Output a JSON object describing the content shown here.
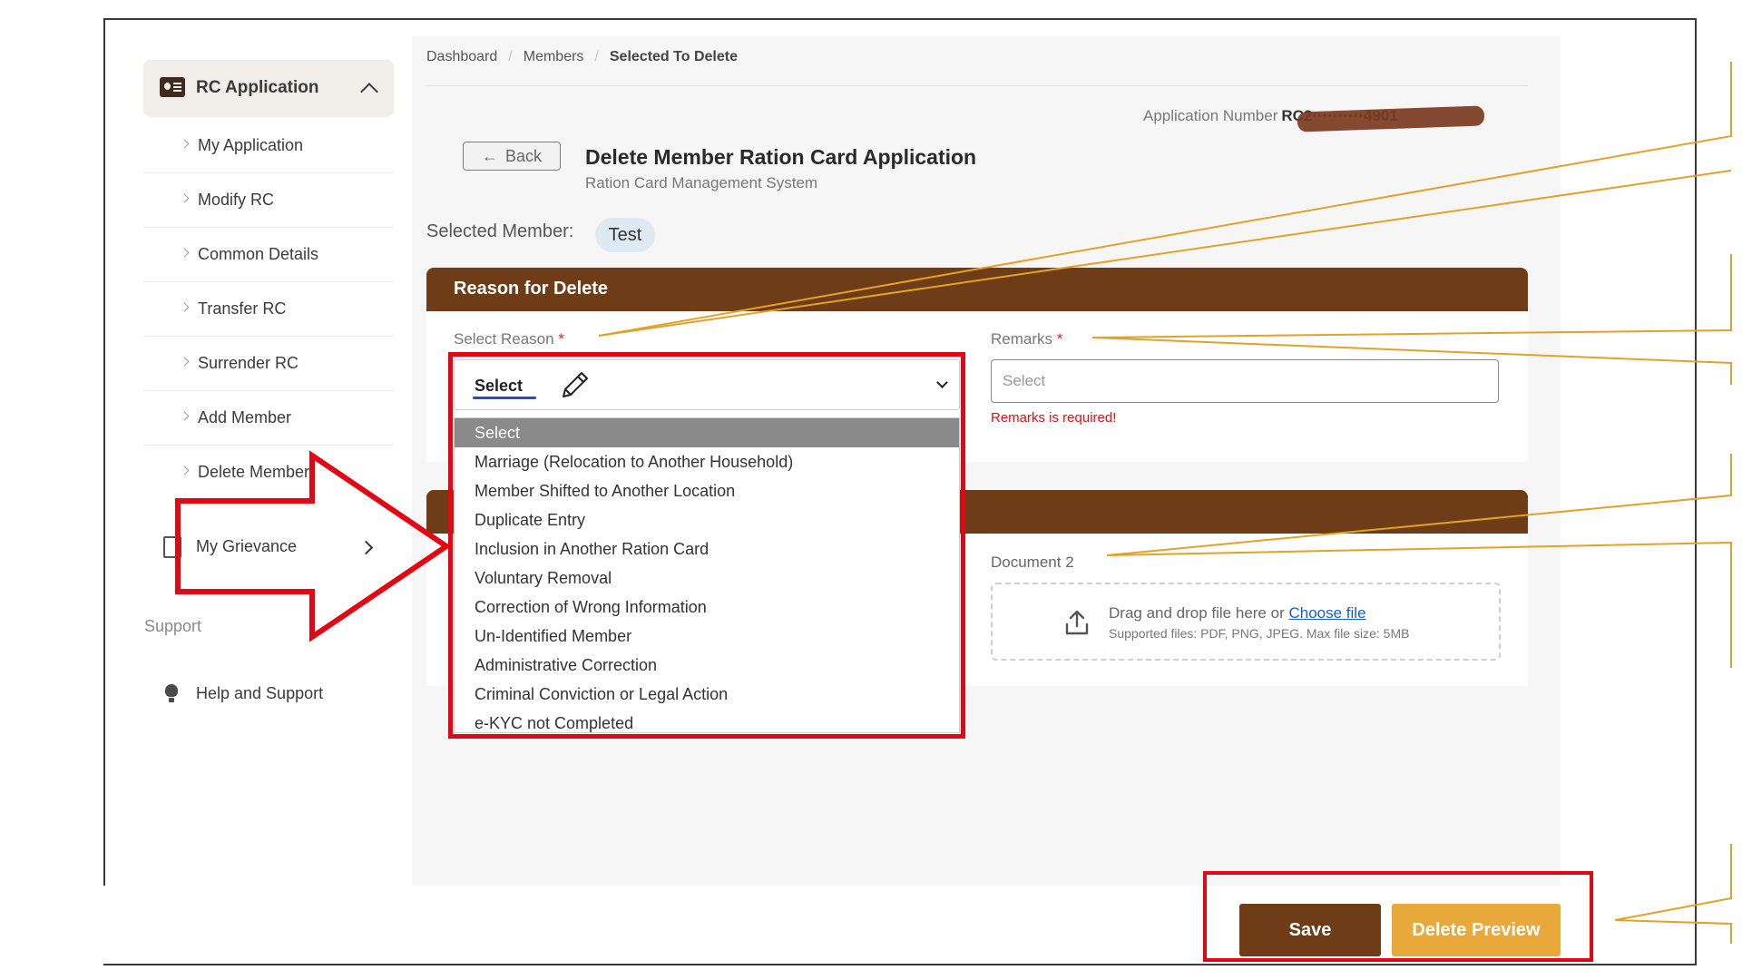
{
  "sidebar": {
    "header": {
      "label": "RC Application",
      "icon": "id-card-icon"
    },
    "items": [
      {
        "label": "My Application"
      },
      {
        "label": "Modify RC"
      },
      {
        "label": "Common Details"
      },
      {
        "label": "Transfer RC"
      },
      {
        "label": "Surrender RC"
      },
      {
        "label": "Add Member"
      },
      {
        "label": "Delete Member"
      }
    ],
    "grievance": {
      "label": "My Grievance"
    },
    "support_heading": "Support",
    "help": {
      "label": "Help and Support"
    }
  },
  "breadcrumb": {
    "items": [
      "Dashboard",
      "Members",
      "Selected To Delete"
    ]
  },
  "application": {
    "label": "Application Number",
    "value": "RC2··········4901"
  },
  "header": {
    "back_label": "Back",
    "title": "Delete Member Ration Card Application",
    "subtitle": "Ration Card Management System"
  },
  "selected_member": {
    "label": "Selected Member:",
    "value": "Test"
  },
  "reason_section": {
    "title": "Reason for Delete",
    "reason_label": "Select Reason",
    "required_mark": "*",
    "selected_value": "Select",
    "options": [
      "Select",
      "Marriage (Relocation to Another Household)",
      "Member Shifted to Another Location",
      "Duplicate Entry",
      "Inclusion in Another Ration Card",
      "Voluntary Removal",
      "Correction of Wrong Information",
      "Un-Identified Member",
      "Administrative Correction",
      "Criminal Conviction or Legal Action",
      "e-KYC not Completed"
    ],
    "remarks_label": "Remarks",
    "remarks_placeholder": "Select",
    "remarks_error": "Remarks is required!"
  },
  "documents_section": {
    "doc2_label": "Document 2",
    "drop_text": "Drag and drop file here or",
    "choose_link": "Choose file",
    "supported": "Supported files: PDF, PNG, JPEG. Max file size: 5MB"
  },
  "actions": {
    "save_label": "Save",
    "preview_label": "Delete Preview"
  },
  "colors": {
    "brand_brown": "#6e3d17",
    "accent_gold": "#e9a93a",
    "highlight_red": "#e30613",
    "annotation_line": "#e2a12a"
  }
}
